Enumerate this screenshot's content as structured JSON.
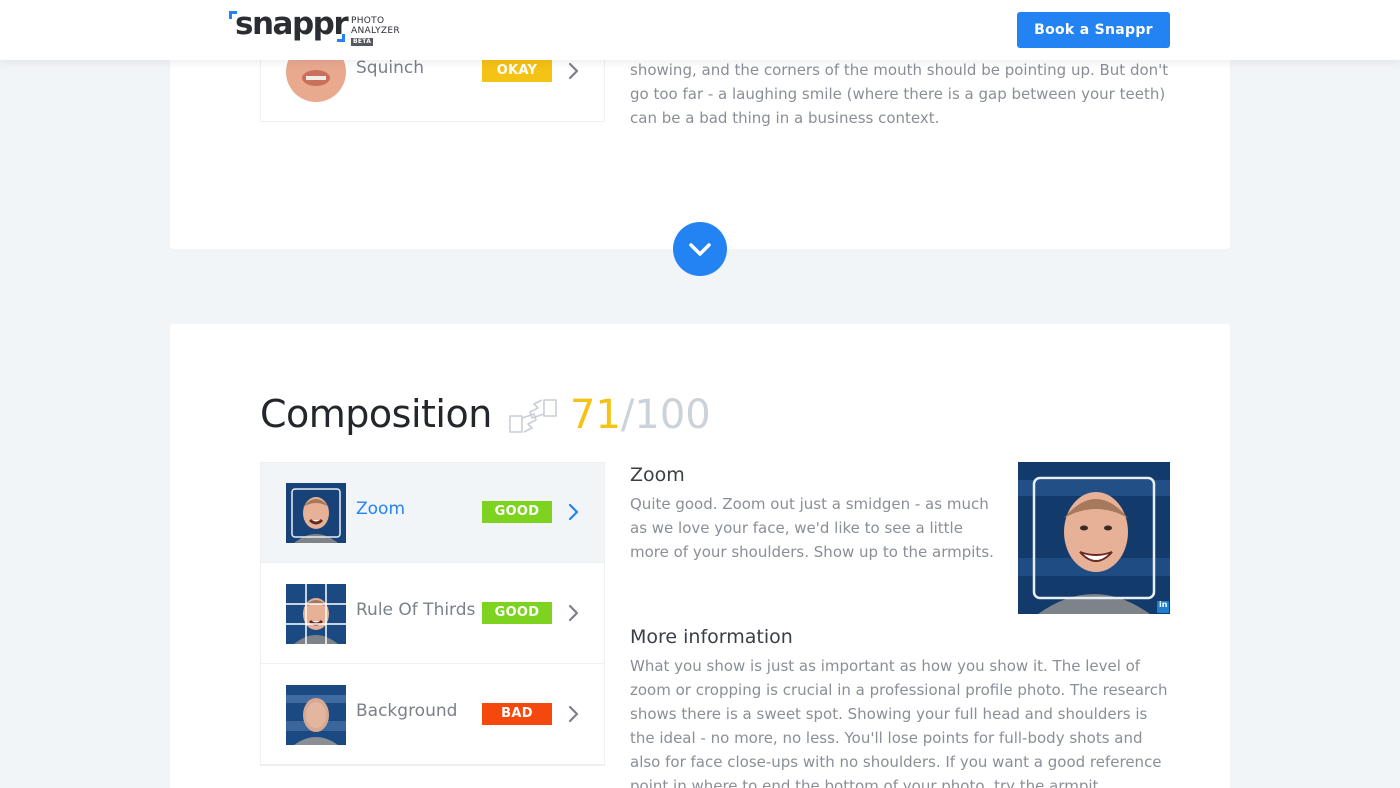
{
  "header": {
    "logo_word": "snappr",
    "logo_line1": "PHOTO",
    "logo_line2": "ANALYZER",
    "logo_badge": "BETA",
    "cta_label": "Book a Snappr"
  },
  "expression_section": {
    "rows": [
      {
        "label": "Squinch",
        "rating": "OKAY"
      }
    ],
    "detail_text": "showing, and the corners of the mouth should be pointing up. But don't go too far - a laughing smile (where there is a gap between your teeth) can be a bad thing in a business context."
  },
  "composition_section": {
    "title": "Composition",
    "score": "71",
    "score_max": "/100",
    "rows": [
      {
        "label": "Zoom",
        "rating": "GOOD",
        "active": true
      },
      {
        "label": "Rule Of Thirds",
        "rating": "GOOD",
        "active": false
      },
      {
        "label": "Background",
        "rating": "BAD",
        "active": false
      }
    ],
    "detail_heading": "Zoom",
    "detail_text": "Quite good. Zoom out just a smidgen - as much as we love your face, we'd like to see a little more of your shoulders. Show up to the armpits.",
    "more_heading": "More information",
    "more_text": "What you show is just as important as how you show it. The level of zoom or cropping is crucial in a professional profile photo. The research shows there is a sweet spot. Showing your full head and shoulders is the ideal - no more, no less. You'll lose points for full-body shots and also for face close-ups with no shoulders. If you want a good reference point in where to end the bottom of your photo, try the armpit.",
    "photo_badge": "in"
  },
  "colors": {
    "accent": "#2483f3",
    "good": "#7ed321",
    "okay": "#f5c216",
    "bad": "#f5480c",
    "background": "#f2f5f8"
  },
  "icons": {
    "scroll_down": "chevron-down-icon",
    "row_arrow": "chevron-right-icon",
    "composition": "hand-frame-icon"
  }
}
